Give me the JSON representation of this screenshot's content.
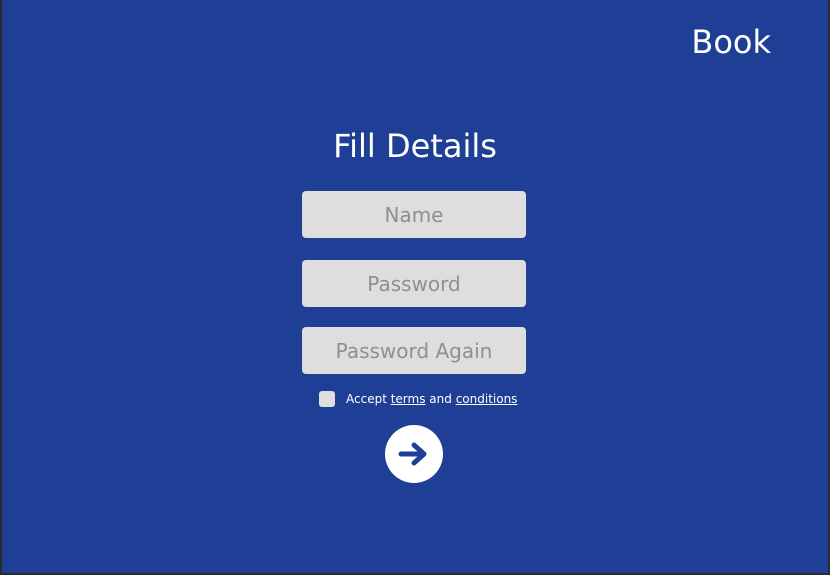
{
  "header": {
    "brand": "Book"
  },
  "form": {
    "title": "Fill Details",
    "name_placeholder": "Name",
    "password_placeholder": "Password",
    "password_again_placeholder": "Password Again",
    "terms": {
      "prefix": "Accept ",
      "terms_link": "terms",
      "middle": " and ",
      "conditions_link": "conditions",
      "checked": false
    },
    "submit_icon": "arrow-right-icon"
  },
  "colors": {
    "background": "#1f3f96",
    "input_background": "#dedede",
    "placeholder": "#8f8f8f",
    "text": "#ffffff",
    "button_background": "#ffffff",
    "button_icon": "#1f3f96"
  }
}
